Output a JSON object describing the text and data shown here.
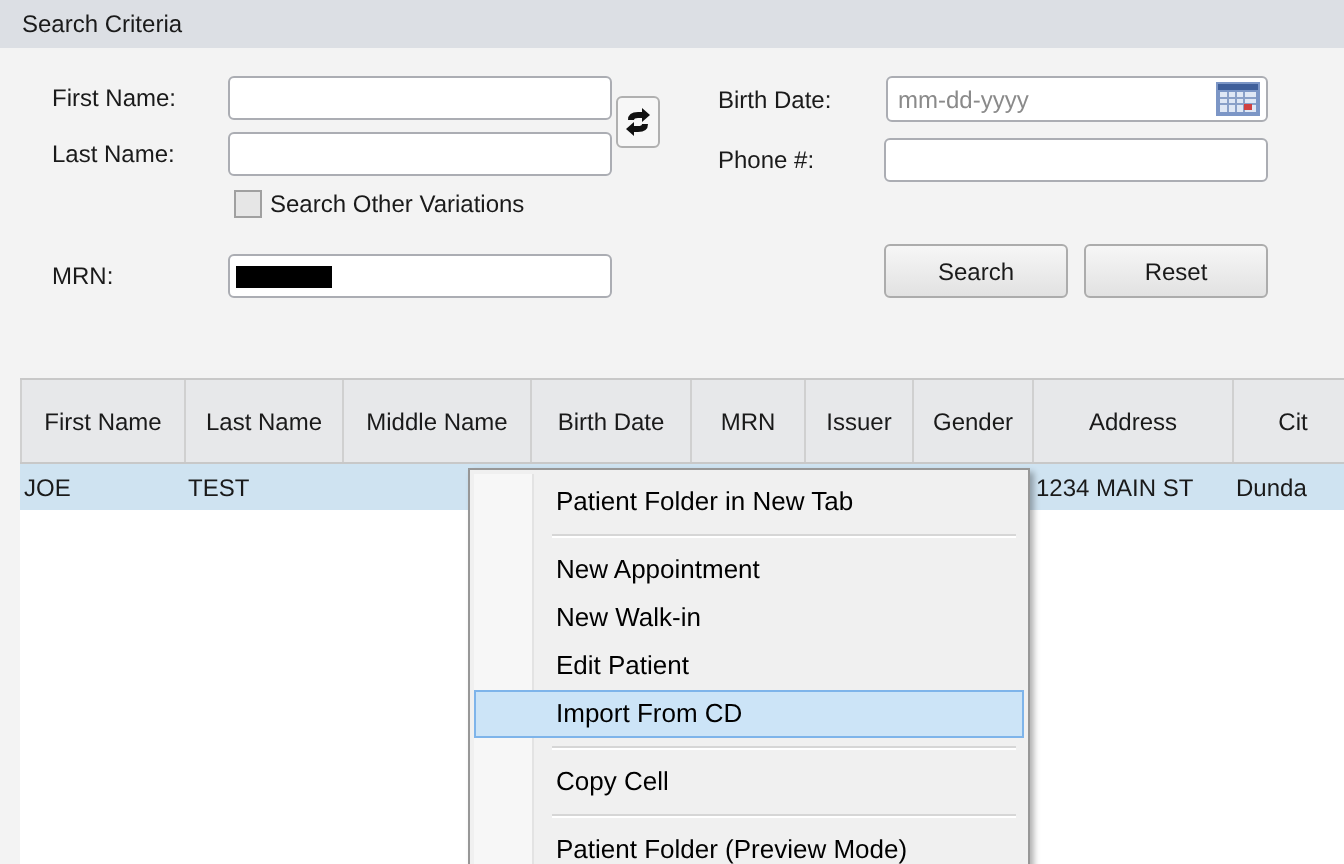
{
  "panel": {
    "title": "Search Criteria"
  },
  "fields": {
    "first_name": {
      "label": "First Name:"
    },
    "last_name": {
      "label": "Last Name:"
    },
    "search_other_variations": {
      "label": "Search Other Variations",
      "checked": false
    },
    "mrn": {
      "label": "MRN:",
      "redacted": true
    },
    "birth_date": {
      "label": "Birth Date:",
      "placeholder": "mm-dd-yyyy"
    },
    "phone": {
      "label": "Phone #:"
    }
  },
  "buttons": [
    {
      "label": "Search"
    },
    {
      "label": "Reset"
    }
  ],
  "table": {
    "columns": [
      "First Name",
      "Last Name",
      "Middle Name",
      "Birth Date",
      "MRN",
      "Issuer",
      "Gender",
      "Address",
      "Cit"
    ],
    "rows": [
      {
        "selected": true,
        "first_name": "JOE",
        "last_name": "TEST",
        "address": "1234 MAIN ST",
        "column_9": "Dunda"
      }
    ]
  },
  "context_menu": {
    "items": [
      {
        "kind": "item",
        "label": "Patient Folder in New Tab",
        "selected": false
      },
      {
        "kind": "separator"
      },
      {
        "kind": "item",
        "label": "New Appointment",
        "selected": false
      },
      {
        "kind": "item",
        "label": "New Walk-in",
        "selected": false
      },
      {
        "kind": "item",
        "label": "Edit Patient",
        "selected": false
      },
      {
        "kind": "item",
        "label": "Import From CD",
        "selected": true
      },
      {
        "kind": "separator"
      },
      {
        "kind": "item",
        "label": "Copy Cell",
        "selected": false
      },
      {
        "kind": "separator"
      },
      {
        "kind": "item",
        "label": "Patient Folder (Preview Mode)",
        "selected": false
      }
    ]
  }
}
